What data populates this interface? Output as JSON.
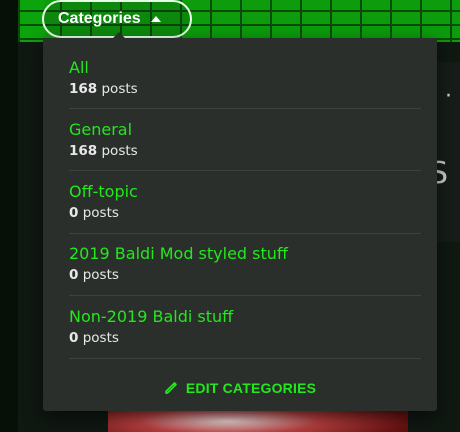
{
  "trigger": {
    "label": "Categories"
  },
  "categories": [
    {
      "name": "All",
      "count": "168",
      "unit": "posts"
    },
    {
      "name": "General",
      "count": "168",
      "unit": "posts"
    },
    {
      "name": "Off-topic",
      "count": "0",
      "unit": "posts"
    },
    {
      "name": "2019 Baldi Mod styled stuff",
      "count": "0",
      "unit": "posts"
    },
    {
      "name": "Non-2019 Baldi stuff",
      "count": "0",
      "unit": "posts"
    }
  ],
  "edit": {
    "label": "EDIT CATEGORIES",
    "icon": "pencil-icon"
  },
  "background": {
    "fragment_1": "s ·",
    "fragment_2": "S"
  },
  "colors": {
    "accent": "#22e81c",
    "dropdown_bg": "#2b2f2c",
    "brick": "#0c9c0c"
  }
}
